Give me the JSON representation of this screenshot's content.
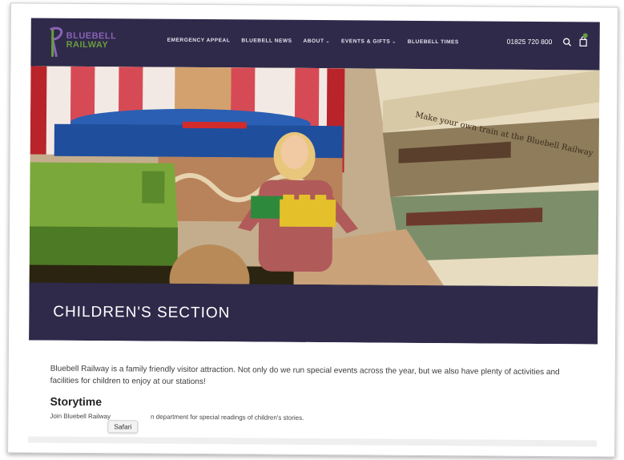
{
  "header": {
    "logo": {
      "line1": "BLUEBELL",
      "line2": "RAILWAY"
    },
    "nav": [
      {
        "label": "EMERGENCY APPEAL",
        "has_menu": false
      },
      {
        "label": "BLUEBELL NEWS",
        "has_menu": false
      },
      {
        "label": "ABOUT",
        "has_menu": true
      },
      {
        "label": "EVENTS & GIFTS",
        "has_menu": true
      },
      {
        "label": "BLUEBELL TIMES",
        "has_menu": false
      }
    ],
    "phone": "01825 720 800",
    "icons": [
      "search-icon",
      "cart-icon"
    ]
  },
  "hero": {
    "mural_text": "Make your own train at the Bluebell Railway"
  },
  "banner": {
    "title": "CHILDREN'S SECTION"
  },
  "content": {
    "intro": "Bluebell Railway is a family friendly visitor attraction. Not only do we run special events across the year, but we also have plenty of activities and facilities for children to enjoy at our stations!",
    "section_title": "Storytime",
    "section_text_start": "Join Bluebell Railway",
    "section_text_end": "n department for special readings of children's stories."
  },
  "tooltip": {
    "label": "Safari"
  },
  "colors": {
    "header_bg": "#2f2a4a",
    "logo_purple": "#8a63b8",
    "logo_green": "#6a9c3c",
    "banner_bg": "#2f2a4a"
  }
}
